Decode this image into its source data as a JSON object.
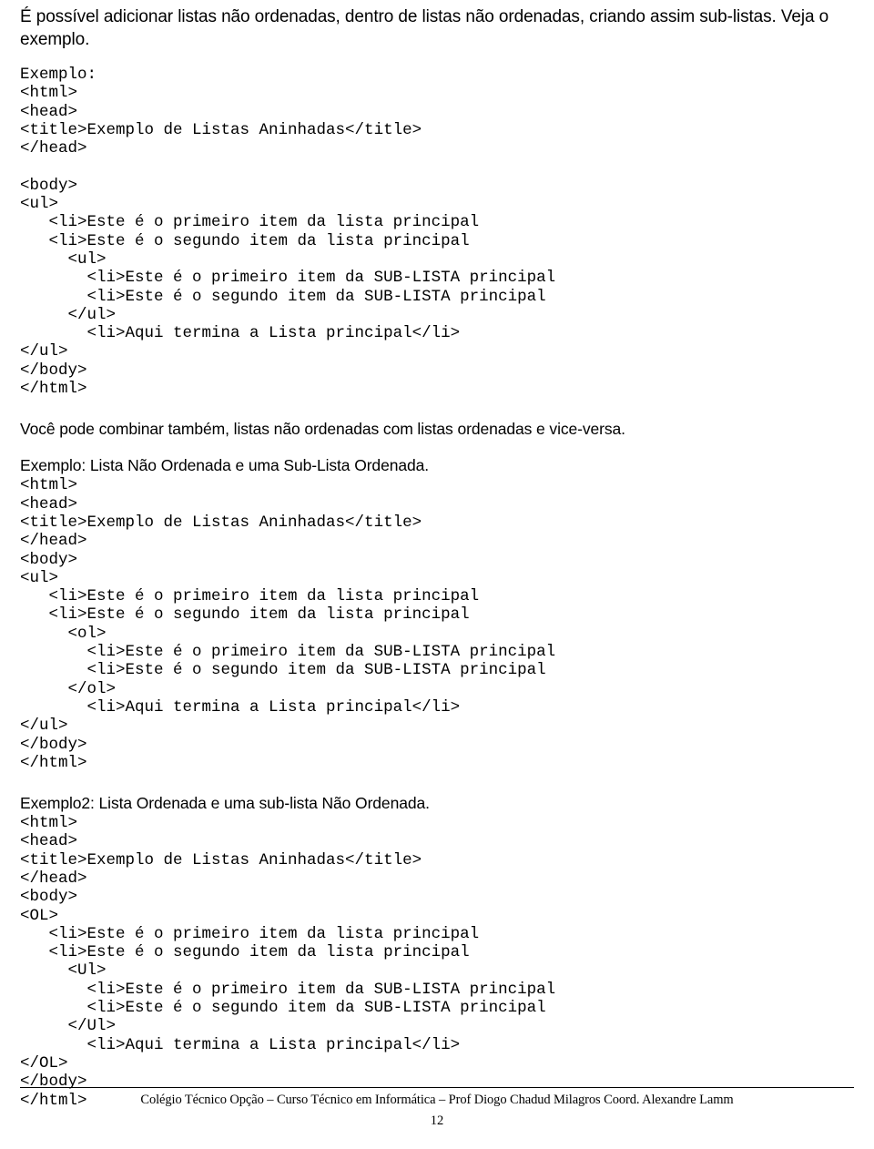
{
  "document": {
    "intro_paragraph": "É possível adicionar listas não ordenadas, dentro de listas não ordenadas, criando assim sub-listas. Veja o exemplo.",
    "section1": {
      "label": "Exemplo:",
      "code": "<html>\n<head>\n<title>Exemplo de Listas Aninhadas</title>\n</head>\n\n<body>\n<ul>\n   <li>Este é o primeiro item da lista principal\n   <li>Este é o segundo item da lista principal\n     <ul>\n       <li>Este é o primeiro item da SUB-LISTA principal\n       <li>Este é o segundo item da SUB-LISTA principal\n     </ul>\n       <li>Aqui termina a Lista principal</li>\n</ul>\n</body>\n</html>"
    },
    "paragraph2": "Você pode combinar também, listas não ordenadas com listas ordenadas e vice-versa.",
    "section2": {
      "label": "Exemplo: Lista Não Ordenada e uma Sub-Lista Ordenada.",
      "code": "<html>\n<head>\n<title>Exemplo de Listas Aninhadas</title>\n</head>\n<body>\n<ul>\n   <li>Este é o primeiro item da lista principal\n   <li>Este é o segundo item da lista principal\n     <ol>\n       <li>Este é o primeiro item da SUB-LISTA principal\n       <li>Este é o segundo item da SUB-LISTA principal\n     </ol>\n       <li>Aqui termina a Lista principal</li>\n</ul>\n</body>\n</html>"
    },
    "section3": {
      "label": "Exemplo2: Lista Ordenada e uma sub-lista Não Ordenada.",
      "code": "<html>\n<head>\n<title>Exemplo de Listas Aninhadas</title>\n</head>\n<body>\n<OL>\n   <li>Este é o primeiro item da lista principal\n   <li>Este é o segundo item da lista principal\n     <Ul>\n       <li>Este é o primeiro item da SUB-LISTA principal\n       <li>Este é o segundo item da SUB-LISTA principal\n     </Ul>\n       <li>Aqui termina a Lista principal</li>\n</OL>\n</body>\n</html>"
    },
    "footer": {
      "text": "Colégio Técnico Opção – Curso Técnico em Informática – Prof Diogo Chadud Milagros  Coord. Alexandre Lamm",
      "page_number": "12"
    }
  }
}
